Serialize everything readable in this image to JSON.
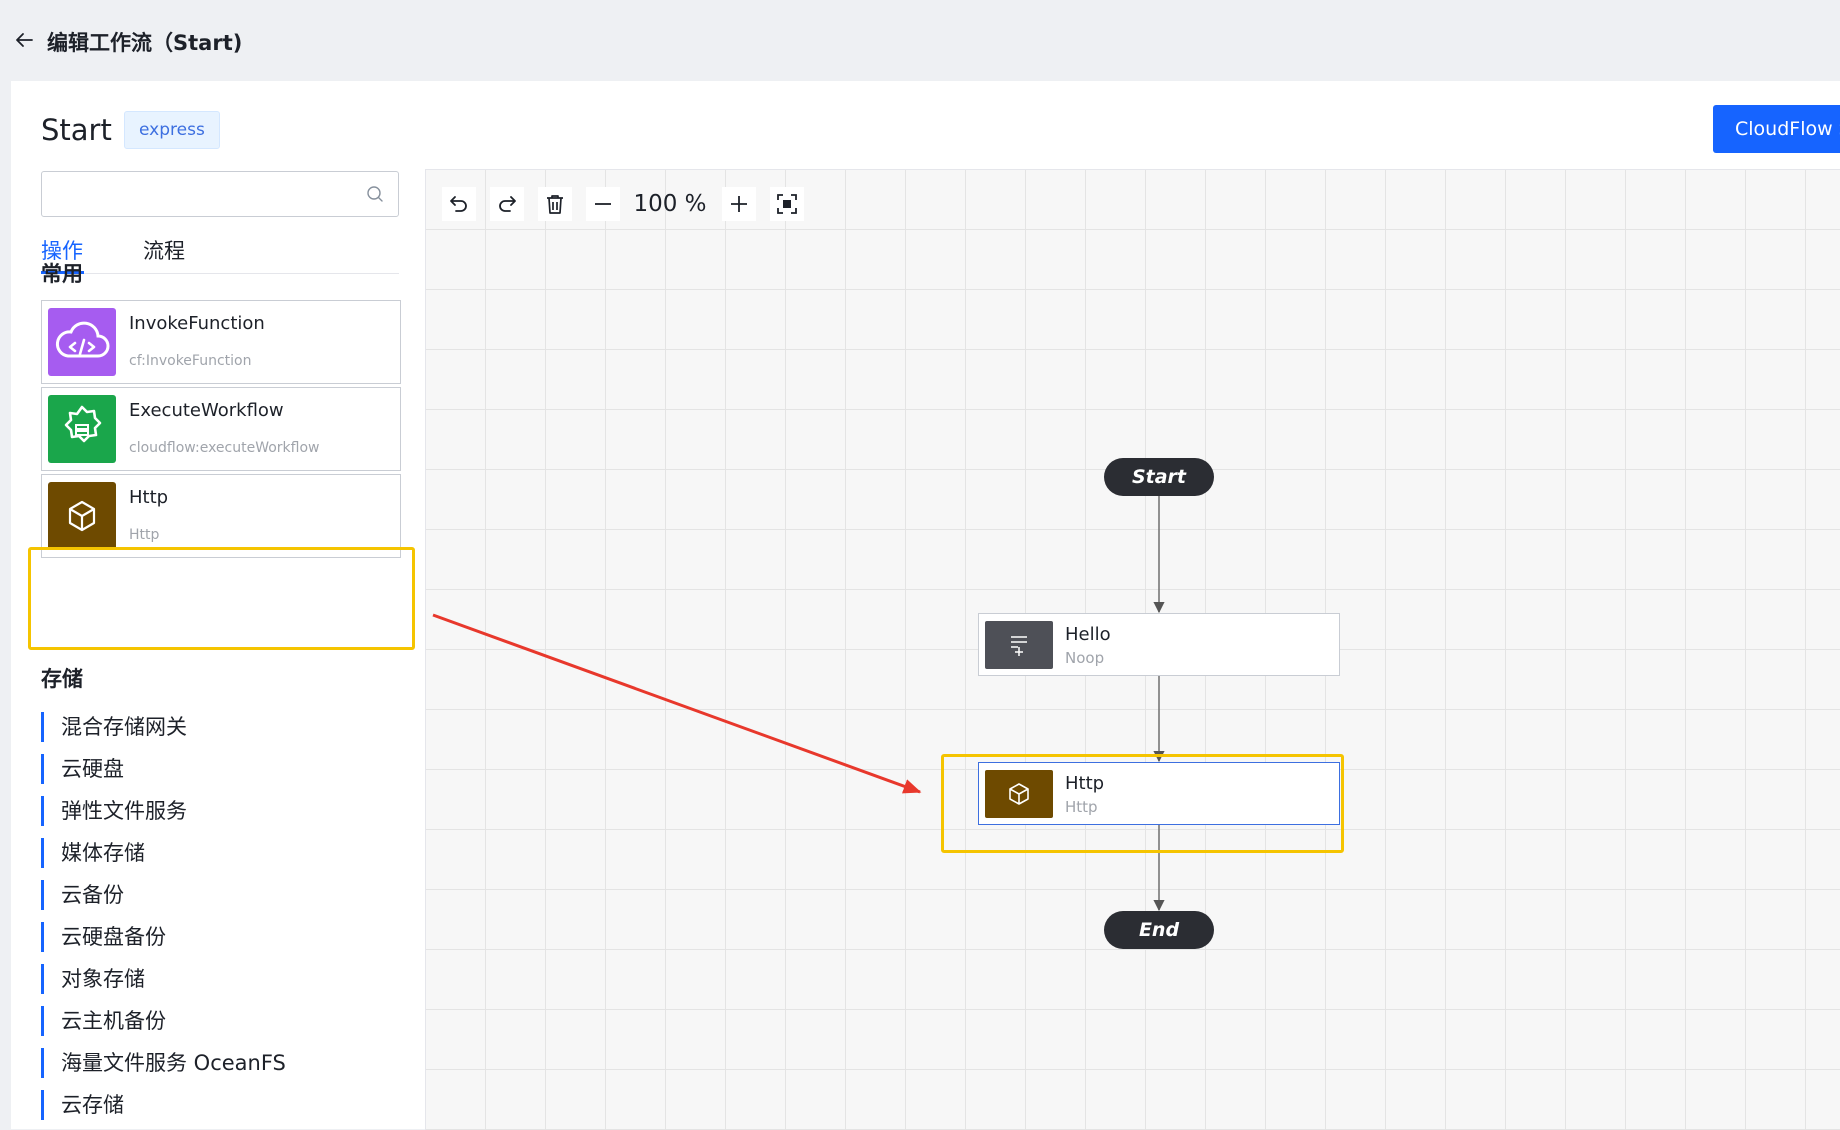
{
  "header": {
    "title": "编辑工作流（Start)"
  },
  "workflow": {
    "name": "Start",
    "badge": "express"
  },
  "top_button": {
    "label": "CloudFlow St"
  },
  "search": {
    "placeholder": "",
    "value": ""
  },
  "tabs": [
    {
      "label": "操作",
      "active": true
    },
    {
      "label": "流程",
      "active": false
    }
  ],
  "sections": {
    "common": "常用",
    "storage": "存储"
  },
  "common_items": [
    {
      "name": "InvokeFunction",
      "sub": "cf:InvokeFunction",
      "icon": "cloud-code-icon",
      "color": "#a65cf0"
    },
    {
      "name": "ExecuteWorkflow",
      "sub": "cloudflow:executeWorkflow",
      "icon": "workflow-icon",
      "color": "#1aa64b"
    },
    {
      "name": "Http",
      "sub": "Http",
      "icon": "cube-icon",
      "color": "#6e4a00"
    }
  ],
  "storage_items": [
    "混合存储网关",
    "云硬盘",
    "弹性文件服务",
    "媒体存储",
    "云备份",
    "云硬盘备份",
    "对象存储",
    "云主机备份",
    "海量文件服务 OceanFS",
    "云存储"
  ],
  "toolbar": {
    "zoom": "100 %"
  },
  "flow": {
    "start_label": "Start",
    "end_label": "End",
    "nodes": [
      {
        "name": "Hello",
        "type": "Noop",
        "icon": "noop-icon",
        "color": "#4e5057"
      },
      {
        "name": "Http",
        "type": "Http",
        "icon": "cube-icon",
        "color": "#6e4a00"
      }
    ]
  },
  "colors": {
    "accent": "#1664ff",
    "highlight": "#f5c400",
    "arrow": "#e8382c"
  }
}
